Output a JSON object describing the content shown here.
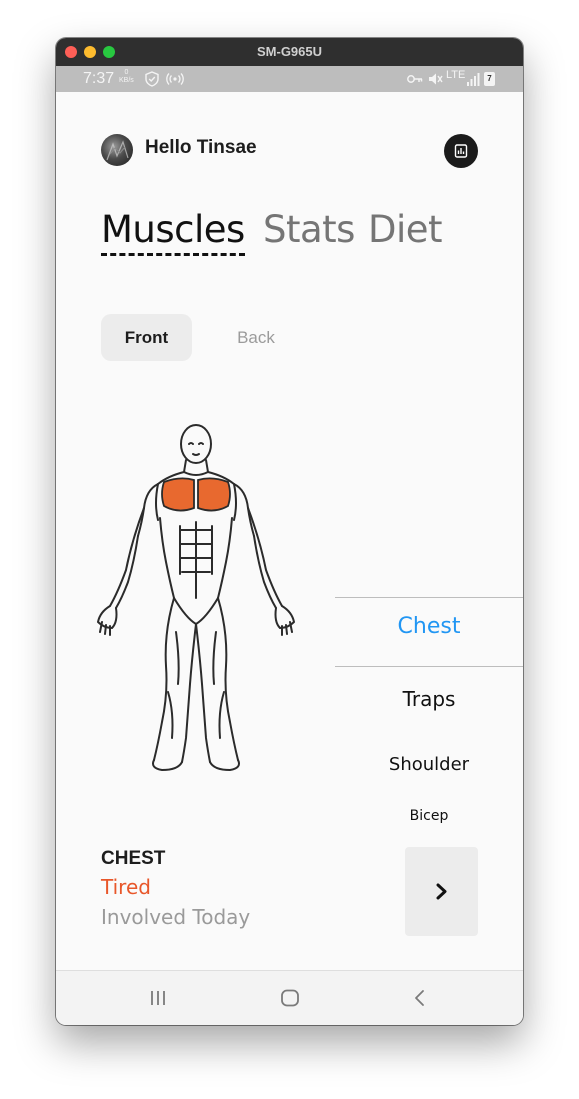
{
  "window": {
    "title": "SM-G965U"
  },
  "status_bar": {
    "time": "7:37",
    "net_speed_value": "0",
    "net_speed_unit": "KB/s",
    "network": "LTE",
    "battery_level": "7",
    "left_icons": [
      "vpn-shield-icon",
      "hotspot-icon"
    ],
    "right_icons": [
      "key-icon",
      "mute-icon",
      "lte-icon",
      "signal-icon",
      "battery-icon"
    ]
  },
  "header": {
    "greeting": "Hello Tinsae",
    "avatar_icon": "avatar",
    "stats_icon": "bar-chart-icon"
  },
  "tabs": [
    {
      "label": "Muscles",
      "active": true
    },
    {
      "label": "Stats",
      "active": false
    },
    {
      "label": "Diet",
      "active": false
    }
  ],
  "view_toggle": {
    "front": "Front",
    "back": "Back",
    "selected": "Front"
  },
  "body_map": {
    "highlighted_muscle": "Chest",
    "highlight_color": "#e8692f"
  },
  "muscle_picker": {
    "selected": "Chest",
    "items": [
      "Chest",
      "Traps",
      "Shoulder",
      "Bicep"
    ]
  },
  "detail": {
    "name": "CHEST",
    "status": "Tired",
    "note": "Involved Today",
    "next_icon": "chevron-right-icon"
  },
  "nav_bar": [
    "recent-apps-icon",
    "home-icon",
    "back-icon"
  ],
  "colors": {
    "accent": "#2196f3",
    "status_tired": "#e8572a",
    "text_dark": "#1d1d1d"
  }
}
